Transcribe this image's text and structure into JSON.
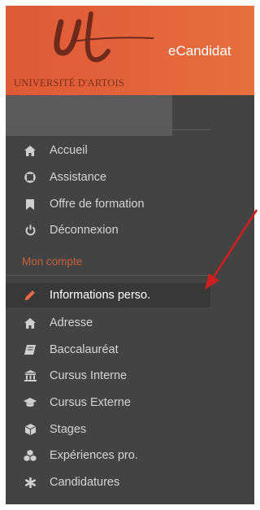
{
  "header": {
    "logo_text": "UNIVERSITÉ D'ARTOIS",
    "app_title": "eCandidat",
    "brand_color": "#e2643b"
  },
  "menu": [
    {
      "label": "Accueil",
      "icon": "home-icon"
    },
    {
      "label": "Assistance",
      "icon": "life-ring-icon"
    },
    {
      "label": "Offre de formation",
      "icon": "bookmark-icon"
    },
    {
      "label": "Déconnexion",
      "icon": "power-icon"
    }
  ],
  "account": {
    "title": "Mon compte",
    "items": [
      {
        "label": "Informations perso.",
        "icon": "pencil-icon",
        "active": true
      },
      {
        "label": "Adresse",
        "icon": "home-icon"
      },
      {
        "label": "Baccalauréat",
        "icon": "book-icon"
      },
      {
        "label": "Cursus Interne",
        "icon": "institution-icon"
      },
      {
        "label": "Cursus Externe",
        "icon": "graduation-cap-icon"
      },
      {
        "label": "Stages",
        "icon": "cube-icon"
      },
      {
        "label": "Expériences pro.",
        "icon": "cubes-icon"
      },
      {
        "label": "Candidatures",
        "icon": "asterisk-icon"
      }
    ]
  },
  "annotation": {
    "arrow_color": "#cc2020"
  }
}
